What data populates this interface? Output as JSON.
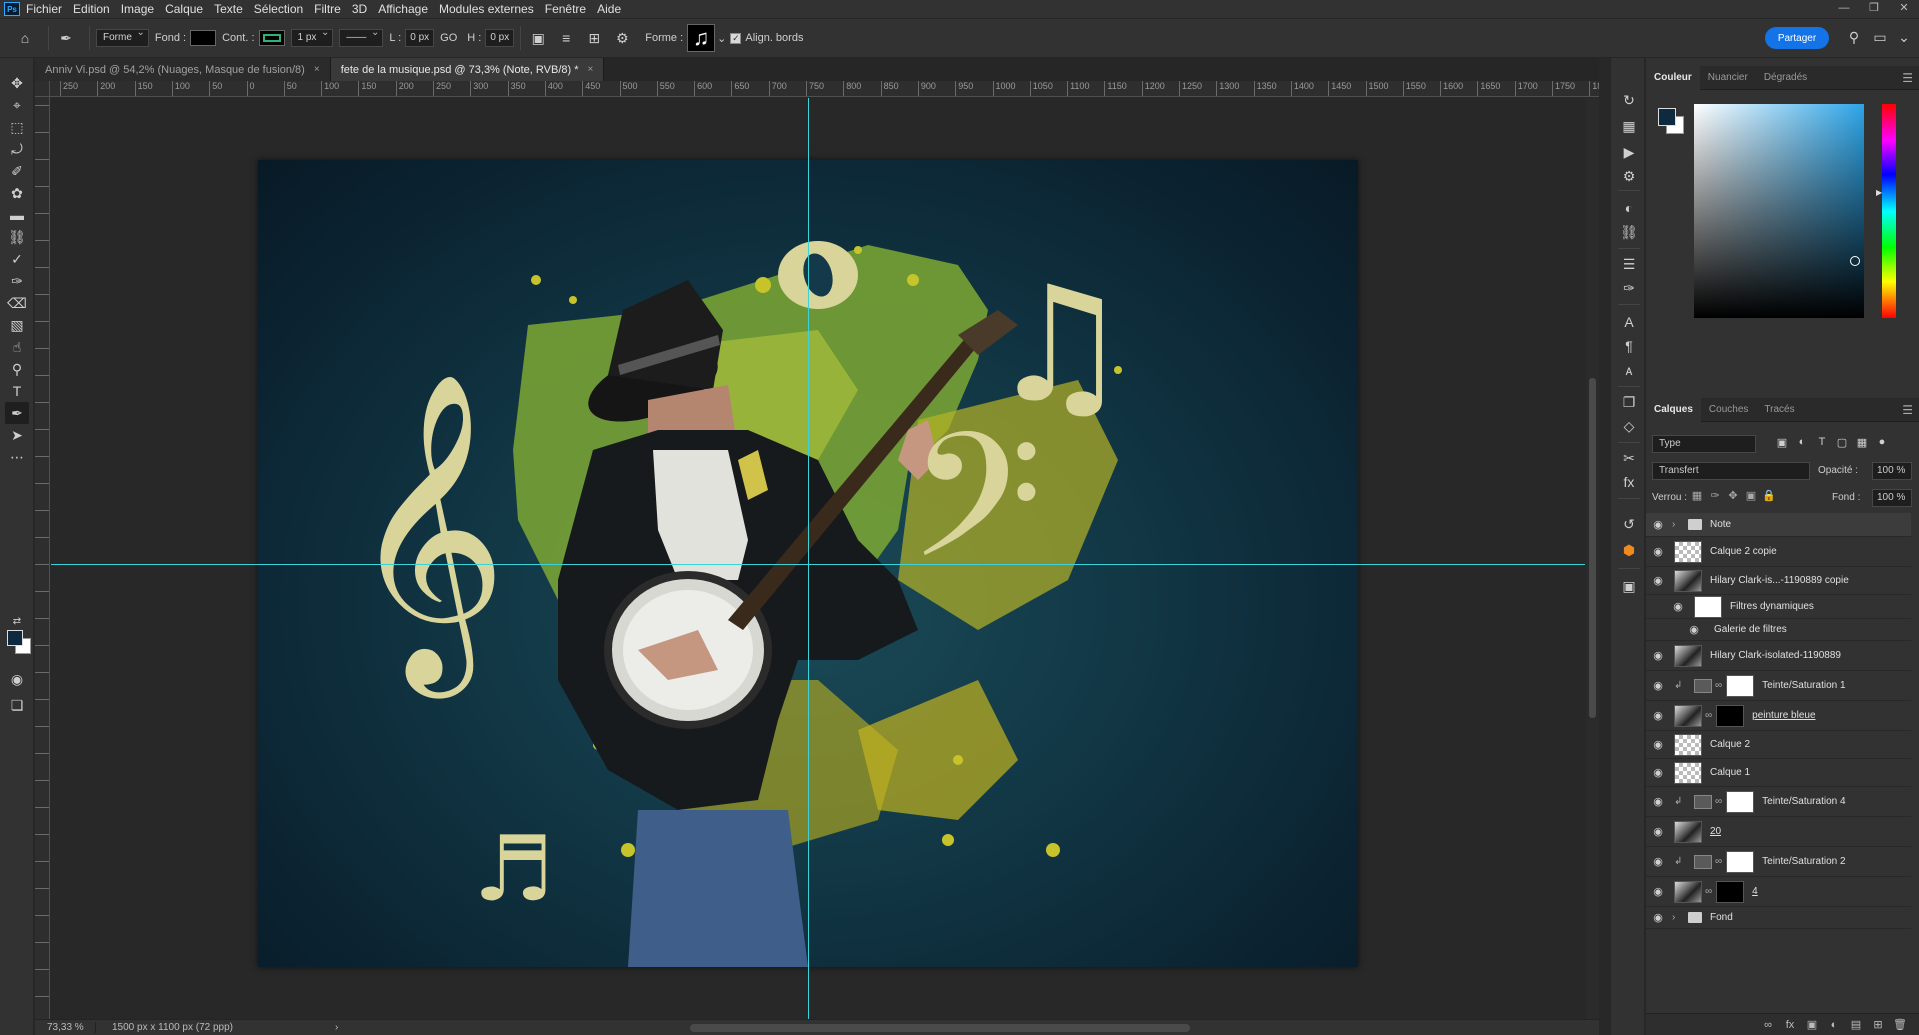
{
  "app": {
    "logo": "Ps"
  },
  "menu": [
    "Fichier",
    "Edition",
    "Image",
    "Calque",
    "Texte",
    "Sélection",
    "Filtre",
    "3D",
    "Affichage",
    "Modules externes",
    "Fenêtre",
    "Aide"
  ],
  "options": {
    "mode": "Forme",
    "fill_label": "Fond :",
    "stroke_label": "Cont. :",
    "stroke_width": "1 px",
    "w_label": "L :",
    "w_value": "0 px",
    "link_label": "GO",
    "h_label": "H :",
    "h_value": "0 px",
    "shape_label": "Forme :",
    "align_edges": "Align. bords",
    "share": "Partager"
  },
  "tabs": [
    {
      "label": "Anniv Vi.psd @ 54,2% (Nuages, Masque de fusion/8)",
      "close": "×"
    },
    {
      "label": "fete de la musique.psd @ 73,3% (Note, RVB/8) *",
      "close": "×"
    }
  ],
  "ruler": [
    "250",
    "200",
    "150",
    "100",
    "50",
    "0",
    "50",
    "100",
    "150",
    "200",
    "250",
    "300",
    "350",
    "400",
    "450",
    "500",
    "550",
    "600",
    "650",
    "700",
    "750",
    "800",
    "850",
    "900",
    "950",
    "1000",
    "1050",
    "1100",
    "1150",
    "1200",
    "1250",
    "1300",
    "1350",
    "1400",
    "1450",
    "1500",
    "1550",
    "1600",
    "1650",
    "1700",
    "1750",
    "18"
  ],
  "status": {
    "zoom": "73,33 %",
    "doc": "1500 px x 1100 px (72 ppp)",
    "arrow": "›"
  },
  "color_panel": {
    "tabs": [
      "Couleur",
      "Nuancier",
      "Dégradés"
    ],
    "foreground": "#0e2a3e",
    "background": "#ffffff"
  },
  "layers_panel": {
    "tabs": [
      "Calques",
      "Couches",
      "Tracés"
    ],
    "filter": "Type",
    "blend_mode": "Transfert",
    "opacity_label": "Opacité :",
    "opacity": "100 %",
    "lock_label": "Verrou :",
    "fill_label": "Fond :",
    "fill": "100 %",
    "layers": [
      {
        "name": "Note",
        "kind": "folder",
        "selected": true
      },
      {
        "name": "Calque 2 copie",
        "kind": "layer"
      },
      {
        "name": "Hilary Clark-is...-1190889 copie",
        "kind": "smart"
      },
      {
        "name": "Filtres dynamiques",
        "kind": "filter"
      },
      {
        "name": "Galerie de filtres",
        "kind": "filter-item"
      },
      {
        "name": "Hilary Clark-isolated-1190889",
        "kind": "smart"
      },
      {
        "name": "Teinte/Saturation 1",
        "kind": "adjust"
      },
      {
        "name": "peinture bleue",
        "kind": "masked"
      },
      {
        "name": "Calque 2",
        "kind": "layer"
      },
      {
        "name": "Calque 1",
        "kind": "layer"
      },
      {
        "name": "Teinte/Saturation 4",
        "kind": "adjust"
      },
      {
        "name": "20",
        "kind": "layer"
      },
      {
        "name": "Teinte/Saturation 2",
        "kind": "adjust"
      },
      {
        "name": "4",
        "kind": "masked"
      },
      {
        "name": "Fond",
        "kind": "folder"
      }
    ]
  },
  "icons": {
    "tools": [
      "move-icon",
      "crop-icon",
      "marquee-icon",
      "lasso-icon",
      "quick-select-icon",
      "healing-icon",
      "ruler-icon",
      "stamp-icon",
      "eyedropper-icon",
      "brush-icon",
      "eraser-icon",
      "gradient-icon",
      "smudge-icon",
      "dodge-icon",
      "type-icon",
      "pen-icon",
      "path-select-icon",
      "more-tools-icon"
    ],
    "dock": [
      "history-icon",
      "artboard-icon",
      "play-icon",
      "adjust-icon",
      "color-wheel-icon",
      "stamp-icon",
      "sliders-icon",
      "brush-icon",
      "character-icon",
      "paragraph-icon",
      "glyphs-icon",
      "clone-icon",
      "shapes-icon",
      "tools-icon",
      "fx-icon",
      "timeline-icon",
      "3d-icon",
      "plugin-icon"
    ]
  }
}
